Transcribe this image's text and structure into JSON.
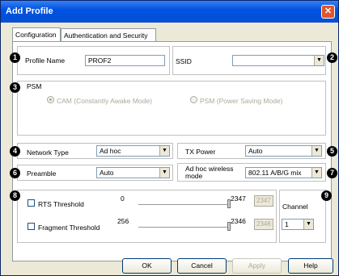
{
  "window": {
    "title": "Add Profile",
    "close_glyph": "✕"
  },
  "tabs": [
    "Configuration",
    "Authentication and Security"
  ],
  "profile": {
    "label": "Profile Name",
    "value": "PROF2"
  },
  "ssid": {
    "label": "SSID",
    "value": ""
  },
  "psm": {
    "label": "PSM",
    "cam": "CAM (Constantly Awake Mode)",
    "psm": "PSM (Power Saving Mode)"
  },
  "network_type": {
    "label": "Network Type",
    "value": "Ad hoc"
  },
  "tx_power": {
    "label": "TX Power",
    "value": "Auto"
  },
  "preamble": {
    "label": "Preamble",
    "value": "Auto"
  },
  "adhoc_mode": {
    "label1": "Ad hoc wireless",
    "label2": "mode",
    "value": "802.11 A/B/G mix"
  },
  "rts": {
    "label": "RTS Threshold",
    "min": "0",
    "max": "2347",
    "value": "2347"
  },
  "frag": {
    "label": "Fragment Threshold",
    "min": "256",
    "max": "2346",
    "value": "2346"
  },
  "channel": {
    "label": "Channel",
    "value": "1"
  },
  "badges": [
    "1",
    "2",
    "3",
    "4",
    "5",
    "6",
    "7",
    "8",
    "9"
  ],
  "buttons": {
    "ok": "OK",
    "cancel": "Cancel",
    "apply": "Apply",
    "help": "Help"
  },
  "arrow_glyph": "▼"
}
